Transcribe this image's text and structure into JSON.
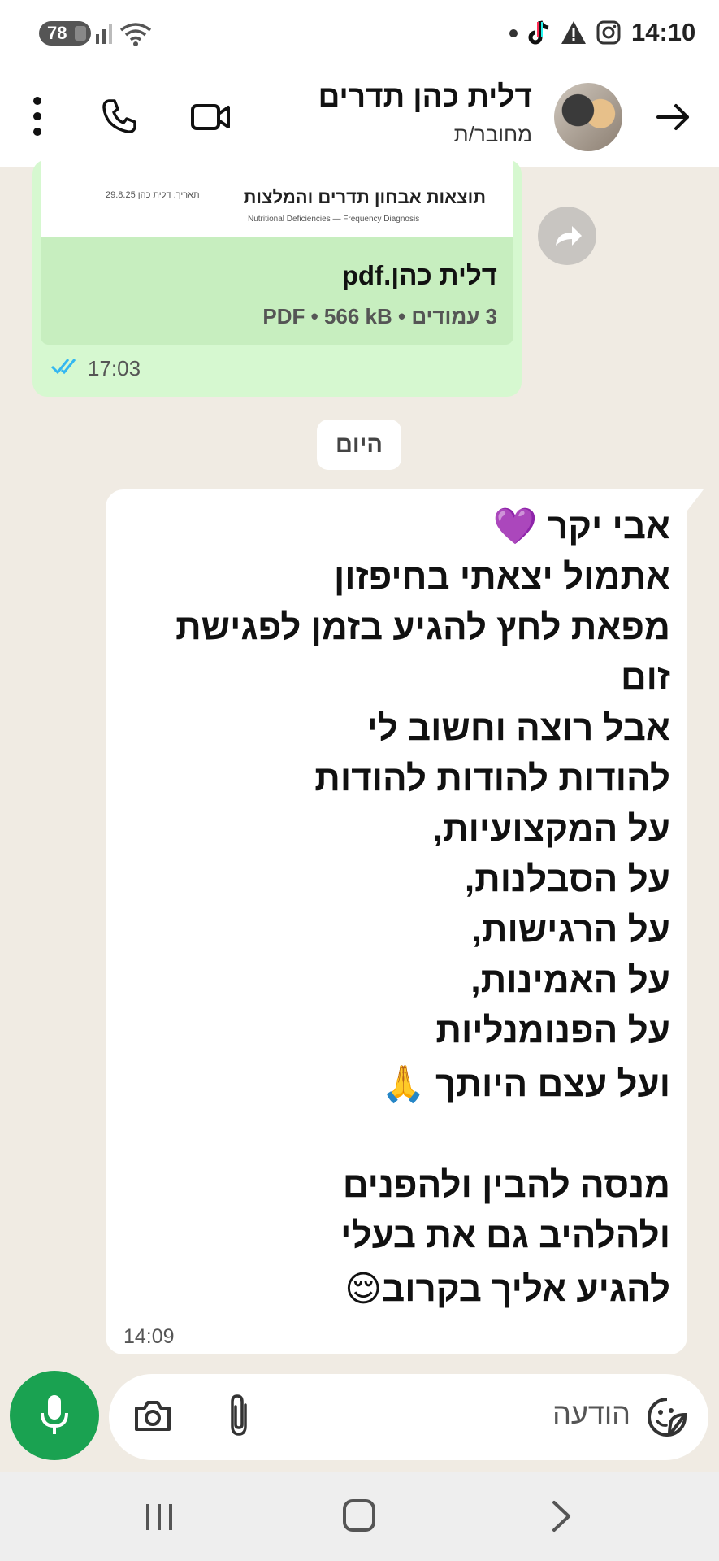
{
  "status_bar": {
    "battery": "78",
    "time": "14:10"
  },
  "header": {
    "contact_name": "דלית כהן תדרים",
    "contact_status": "מחובר/ת"
  },
  "pdf_message": {
    "preview_title": "תוצאות אבחון תדרים והמלצות",
    "preview_small": "29.8.25   תאריך:   דלית כהן",
    "preview_subtitle": "Nutritional Deficiencies — Frequency Diagnosis",
    "file_name": "דלית כהן.pdf",
    "meta": "3 עמודים • PDF • 566 kB",
    "time": "17:03"
  },
  "date_separator": "היום",
  "message": {
    "lines": [
      "אבי יקר 💜",
      "אתמול יצאתי בחיפזון",
      "מפאת לחץ להגיע בזמן לפגישת",
      "זום",
      "אבל רוצה וחשוב לי",
      "להודות להודות להודות",
      "על המקצועיות,",
      "על הסבלנות,",
      "על הרגישות,",
      "על האמינות,",
      "על הפנומנליות",
      "ועל עצם היותך 🙏",
      "",
      "מנסה להבין ולהפנים",
      "ולהלהיב גם את בעלי",
      "להגיע אליך בקרוב😌"
    ],
    "time": "14:09"
  },
  "input": {
    "placeholder": "הודעה"
  },
  "colors": {
    "chat_background": "#f0ebe3",
    "outgoing_bubble": "#d6f8d0",
    "accent_green": "#1aa251",
    "read_ticks": "#34b7f1"
  },
  "icons": [
    "back-arrow-icon",
    "video-call-icon",
    "phone-call-icon",
    "more-options-icon",
    "forward-icon",
    "read-ticks-icon",
    "mic-icon",
    "camera-icon",
    "attach-icon",
    "sticker-icon"
  ]
}
